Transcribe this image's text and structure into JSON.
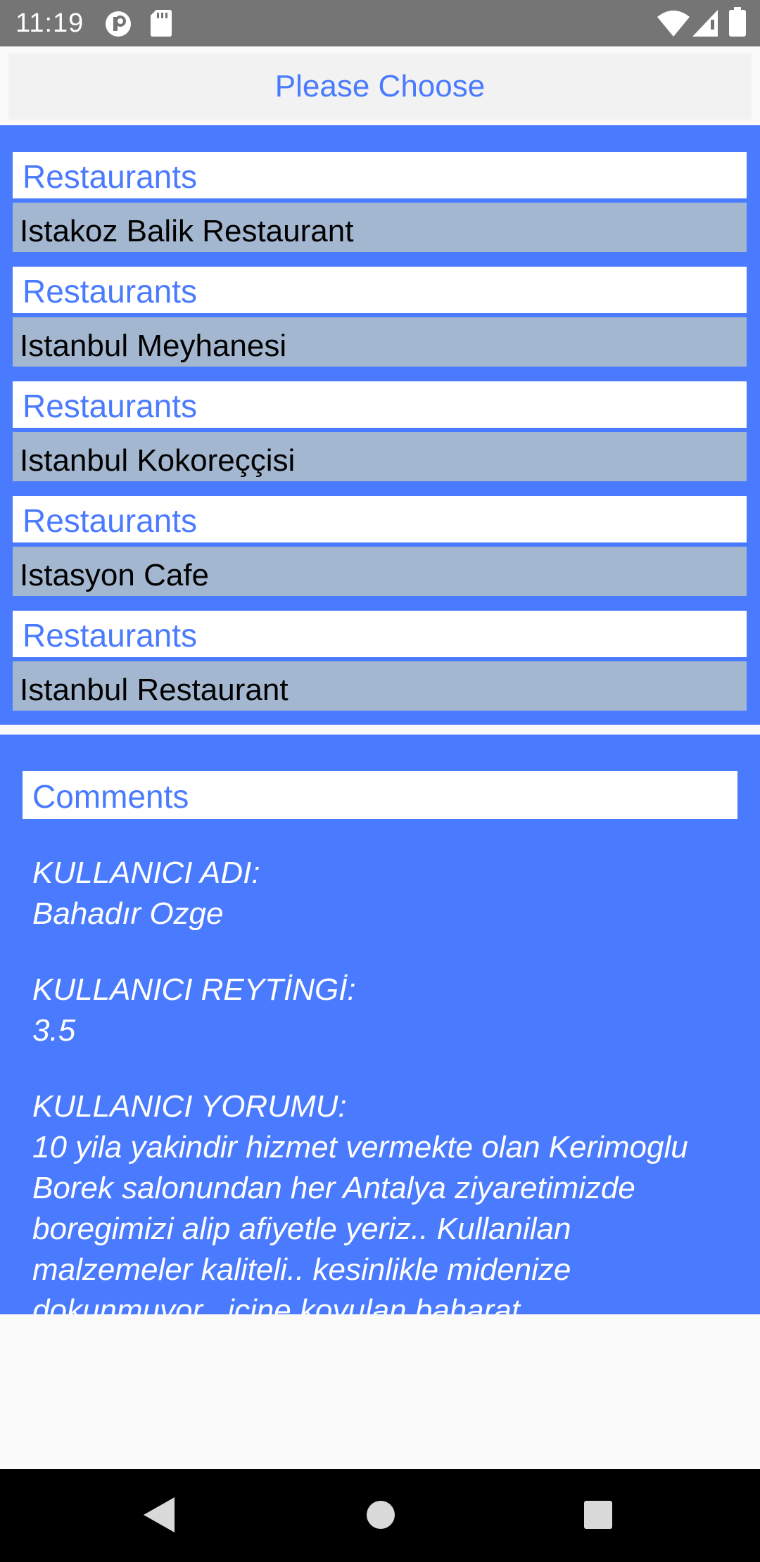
{
  "status_bar": {
    "time": "11:19",
    "icons": [
      "app-notification-icon",
      "sd-card-icon",
      "wifi-icon",
      "signal-icon",
      "battery-icon"
    ]
  },
  "header": {
    "title": "Please Choose"
  },
  "restaurants": [
    {
      "category": "Restaurants",
      "name": "Istakoz Balik Restaurant"
    },
    {
      "category": "Restaurants",
      "name": "Istanbul Meyhanesi"
    },
    {
      "category": "Restaurants",
      "name": "Istanbul Kokoreççisi"
    },
    {
      "category": "Restaurants",
      "name": "Istasyon Cafe"
    },
    {
      "category": "Restaurants",
      "name": "Istanbul Restaurant"
    }
  ],
  "comments": {
    "heading": "Comments",
    "user_name_label": "KULLANICI ADI:",
    "user_name": "Bahadır Ozge",
    "rating_label": "KULLANICI REYTİNGİ:",
    "rating": "3.5",
    "comment_label": "KULLANICI YORUMU:",
    "comment_text": "10 yila yakindir hizmet vermekte olan Kerimoglu Borek salonundan her Antalya ziyaretimizde boregimizi alip afiyetle yeriz.. Kullanilan malzemeler kaliteli.. kesinlikle midenize dokunmuyor.. icine koyulan baharat"
  },
  "colors": {
    "accent": "#4a7bff",
    "item_background": "#a4b7d0",
    "status_bar": "#757575",
    "nav_bar": "#000000"
  },
  "nav_bar": {
    "icons": [
      "back-icon",
      "home-icon",
      "recents-icon"
    ]
  }
}
